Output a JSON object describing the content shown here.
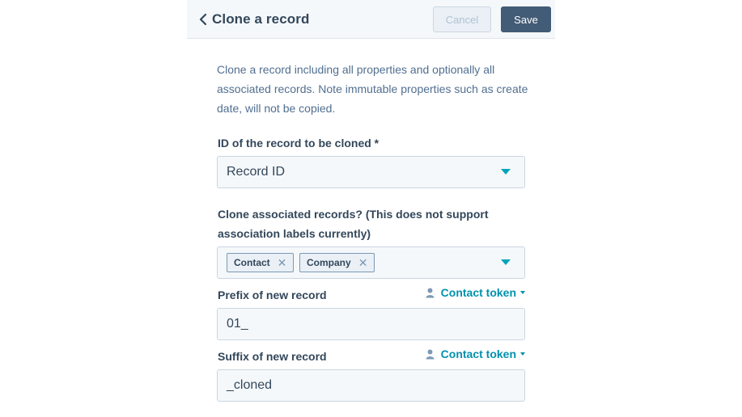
{
  "header": {
    "title": "Clone a record",
    "cancel_label": "Cancel",
    "save_label": "Save"
  },
  "description": "Clone a record including all properties and optionally all associated records. Note immutable properties such as create date, will not be copied.",
  "record_id": {
    "label": "ID of the record to be cloned *",
    "value": "Record ID"
  },
  "associated": {
    "label": "Clone associated records? (This does not support association labels currently)",
    "tags": [
      "Contact",
      "Company"
    ]
  },
  "prefix": {
    "label": "Prefix of new record",
    "token_label": "Contact token",
    "value": "01_"
  },
  "suffix": {
    "label": "Suffix of new record",
    "token_label": "Contact token",
    "value": "_cloned"
  },
  "colors": {
    "header_bg": "#f5f8fa",
    "primary_button": "#425b76",
    "accent": "#00a4bd",
    "link": "#0091ae",
    "text": "#33475b"
  }
}
